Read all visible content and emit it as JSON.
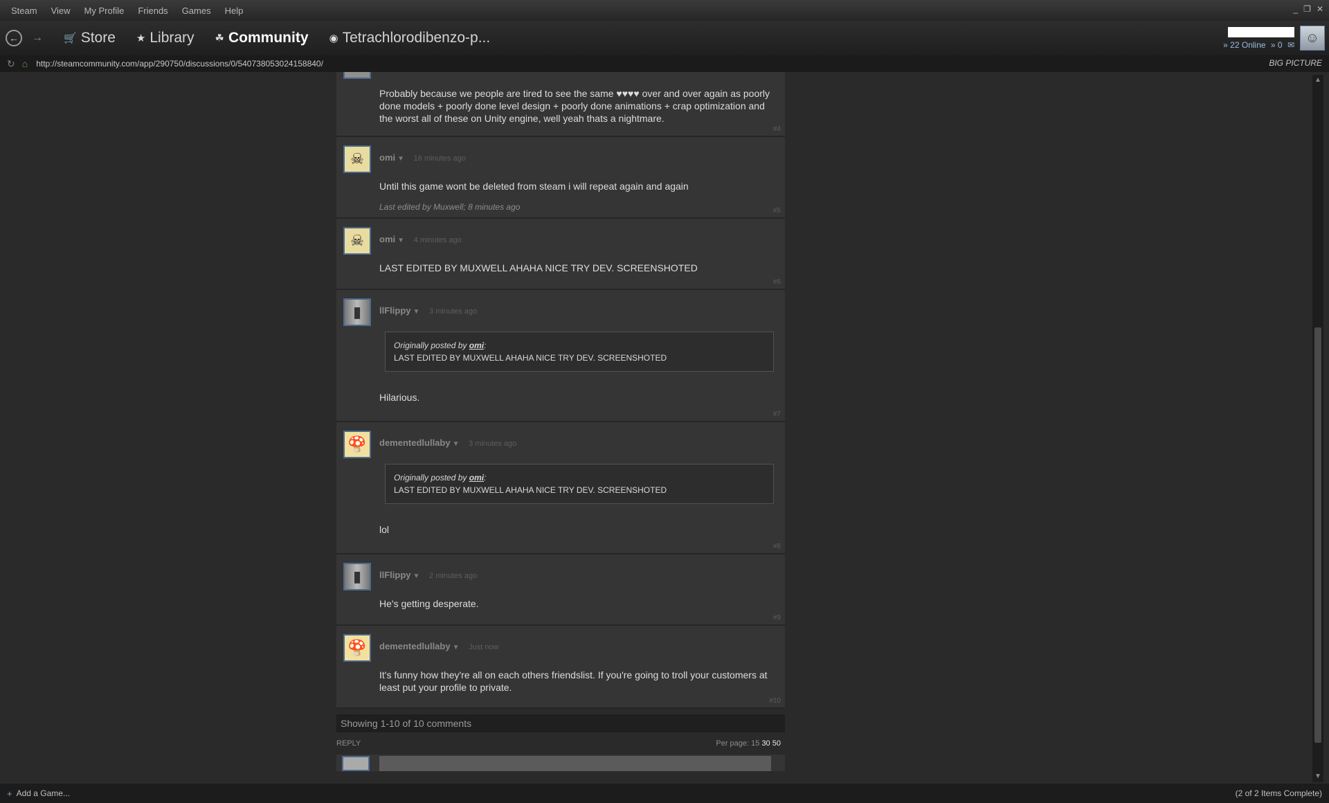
{
  "menu": {
    "items": [
      "Steam",
      "View",
      "My Profile",
      "Friends",
      "Games",
      "Help"
    ],
    "controls": [
      "_",
      "❐",
      "✕"
    ]
  },
  "nav": {
    "store": "Store",
    "library": "Library",
    "community": "Community",
    "page_title": "Tetrachlorodibenzo-p..."
  },
  "user": {
    "online_label": "» 22 Online",
    "messages": "» 0"
  },
  "url": {
    "address": "http://steamcommunity.com/app/290750/discussions/0/540738053024158840/",
    "big_picture": "BIG PICTURE"
  },
  "comments": [
    {
      "author": "",
      "time": "",
      "body": "Probably because we people are tired to see the same ♥♥♥♥ over and over again as poorly done models + poorly done level design + poorly done animations + crap optimization and the worst all of these on Unity engine, well yeah thats a nightmare.",
      "num": "#4"
    },
    {
      "author": "omi",
      "time": "16 minutes ago",
      "body": "Until this game wont be deleted from steam i will repeat again and again",
      "edited": "Last edited by Muxwell; 8 minutes ago",
      "num": "#5"
    },
    {
      "author": "omi",
      "time": "4 minutes ago",
      "body": "LAST EDITED BY MUXWELL AHAHA NICE TRY DEV. SCREENSHOTED",
      "num": "#6"
    },
    {
      "author": "llFlippy",
      "time": "3 minutes ago",
      "quote_by_prefix": "Originally posted by ",
      "quote_by": "omi",
      "quote_text": "LAST EDITED BY MUXWELL AHAHA NICE TRY DEV. SCREENSHOTED",
      "body": "Hilarious.",
      "num": "#7"
    },
    {
      "author": "dementedlullaby",
      "time": "3 minutes ago",
      "quote_by_prefix": "Originally posted by ",
      "quote_by": "omi",
      "quote_text": "LAST EDITED BY MUXWELL AHAHA NICE TRY DEV. SCREENSHOTED",
      "body": "lol",
      "num": "#8"
    },
    {
      "author": "llFlippy",
      "time": "2 minutes ago",
      "body": "He's getting desperate.",
      "num": "#9"
    },
    {
      "author": "dementedlullaby",
      "time": "Just now",
      "body": "It's funny how they're all on each others friendslist. If you're going to troll your customers at least put your profile to private.",
      "num": "#10"
    }
  ],
  "footer": {
    "showing": "Showing 1-10 of 10 comments",
    "reply": "REPLY",
    "per_page_label": "Per page:",
    "per_page_15": "15",
    "per_page_30": "30",
    "per_page_50": "50"
  },
  "status": {
    "add_game": "Add a Game...",
    "items_complete": "(2 of 2 Items Complete)"
  },
  "colors": {
    "accent_blue": "#9bbbe0",
    "background": "#2a2a2a",
    "comment_bg": "#353535"
  }
}
